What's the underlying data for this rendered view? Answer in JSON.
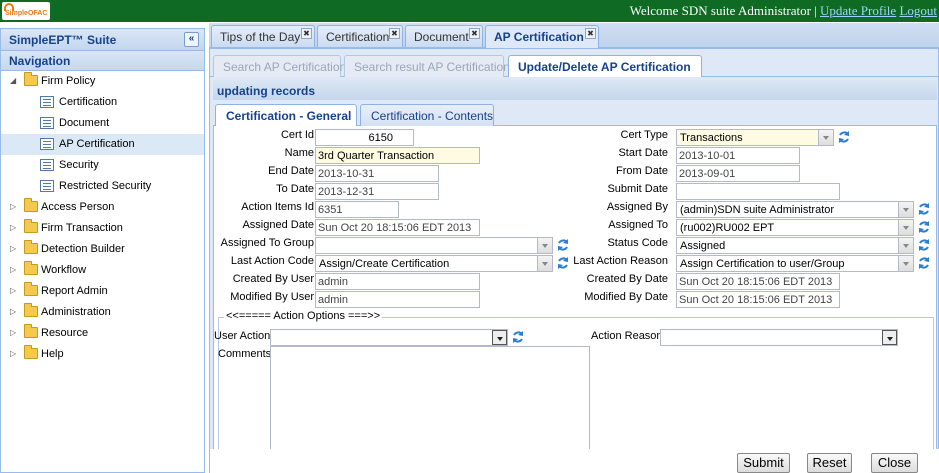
{
  "header": {
    "logo_text": "SimpleOFAC",
    "welcome": "Welcome SDN suite Administrator",
    "separator": "|",
    "update_profile": "Update Profile",
    "logout": "Logout"
  },
  "sidebar": {
    "title": "SimpleEPT™ Suite",
    "collapse_glyph": "«",
    "nav_title": "Navigation",
    "items": [
      {
        "label": "Firm Policy",
        "expanded": true,
        "children": [
          {
            "label": "Certification"
          },
          {
            "label": "Document"
          },
          {
            "label": "AP Certification",
            "selected": true
          },
          {
            "label": "Security"
          },
          {
            "label": "Restricted Security"
          }
        ]
      },
      {
        "label": "Access Person"
      },
      {
        "label": "Firm Transaction"
      },
      {
        "label": "Detection Builder"
      },
      {
        "label": "Workflow"
      },
      {
        "label": "Report Admin"
      },
      {
        "label": "Administration"
      },
      {
        "label": "Resource"
      },
      {
        "label": "Help"
      }
    ]
  },
  "tabs": [
    {
      "label": "Tips of the Day"
    },
    {
      "label": "Certification"
    },
    {
      "label": "Document"
    },
    {
      "label": "AP Certification",
      "active": true
    }
  ],
  "subtabs": [
    {
      "label": "Search AP Certification"
    },
    {
      "label": "Search result AP Certification"
    },
    {
      "label": "Update/Delete AP Certification",
      "active": true
    }
  ],
  "panel_title": "updating records",
  "form_tabs": [
    {
      "label": "Certification - General",
      "active": true
    },
    {
      "label": "Certification - Contents"
    }
  ],
  "form": {
    "cert_id_label": "Cert Id",
    "cert_id": "6150",
    "name_label": "Name",
    "name": "3rd Quarter Transaction",
    "end_date_label": "End Date",
    "end_date": "2013-10-31",
    "to_date_label": "To Date",
    "to_date": "2013-12-31",
    "action_items_id_label": "Action Items Id",
    "action_items_id": "6351",
    "assigned_date_label": "Assigned Date",
    "assigned_date": "Sun Oct 20 18:15:06 EDT 2013",
    "assigned_to_group_label": "Assigned To Group",
    "assigned_to_group": "",
    "last_action_code_label": "Last Action Code",
    "last_action_code": "Assign/Create Certification",
    "created_by_user_label": "Created By User",
    "created_by_user": "admin",
    "modified_by_user_label": "Modified By User",
    "modified_by_user": "admin",
    "cert_type_label": "Cert Type",
    "cert_type": "Transactions",
    "start_date_label": "Start Date",
    "start_date": "2013-10-01",
    "from_date_label": "From Date",
    "from_date": "2013-09-01",
    "submit_date_label": "Submit Date",
    "submit_date": "",
    "assigned_by_label": "Assigned By",
    "assigned_by": "(admin)SDN suite Administrator",
    "assigned_to_label": "Assigned To",
    "assigned_to": "(ru002)RU002 EPT",
    "status_code_label": "Status Code",
    "status_code": "Assigned",
    "last_action_reason_label": "Last Action Reason",
    "last_action_reason": "Assign Certification to user/Group",
    "created_by_date_label": "Created By Date",
    "created_by_date": "Sun Oct 20 18:15:06 EDT 2013",
    "modified_by_date_label": "Modified By Date",
    "modified_by_date": "Sun Oct 20 18:15:06 EDT 2013"
  },
  "action_options": {
    "legend": "<<===== Action Options ===>>",
    "user_action_label": "User Action",
    "user_action": "",
    "action_reason_label": "Action Reason",
    "action_reason": "",
    "comments_label": "Comments",
    "comments": ""
  },
  "buttons": {
    "submit": "Submit",
    "reset": "Reset",
    "close": "Close"
  },
  "colors": {
    "topbar": "#0f6b23",
    "panel_blue": "#dfe8f6",
    "text_blue": "#15428b",
    "highlight_field": "#fffbe2"
  }
}
